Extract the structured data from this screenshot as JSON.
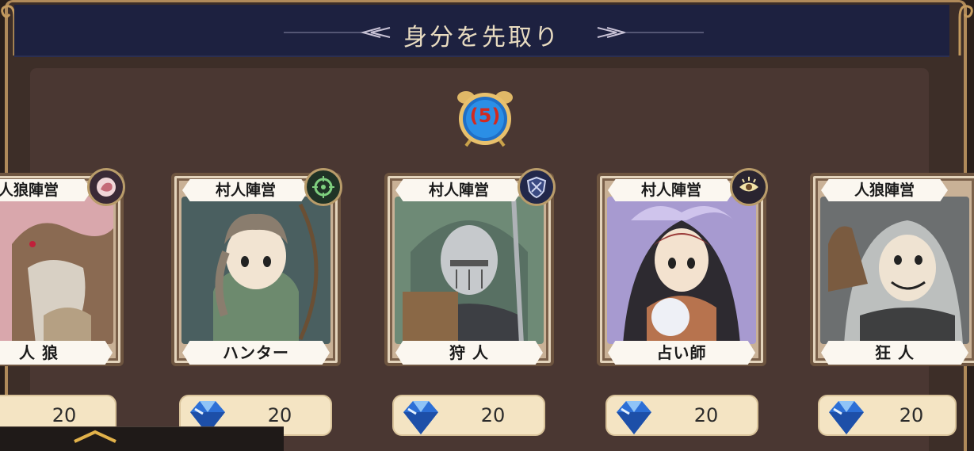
{
  "header": {
    "title": "身分を先取り"
  },
  "timer": {
    "value": "(5)"
  },
  "cards": [
    {
      "faction": "人狼陣営",
      "role": "人 狼",
      "price": "20",
      "badge_icon": "werewolf-icon",
      "badge_color": "#3a2a36"
    },
    {
      "faction": "村人陣営",
      "role": "ハンター",
      "price": "20",
      "badge_icon": "crosshair-icon",
      "badge_color": "#203326"
    },
    {
      "faction": "村人陣営",
      "role": "狩 人",
      "price": "20",
      "badge_icon": "shield-icon",
      "badge_color": "#22284a"
    },
    {
      "faction": "村人陣営",
      "role": "占い師",
      "price": "20",
      "badge_icon": "eye-icon",
      "badge_color": "#2a2430"
    },
    {
      "faction": "人狼陣営",
      "role": "狂 人",
      "price": "20",
      "badge_icon": "mask-icon",
      "badge_color": "#3a2a36"
    }
  ],
  "colors": {
    "header_bg": "#1d2140",
    "panel_bg": "#4a3732",
    "gold": "#b08a5a",
    "price_bg": "#f4e4c3",
    "timer_text": "#d32a1f"
  }
}
